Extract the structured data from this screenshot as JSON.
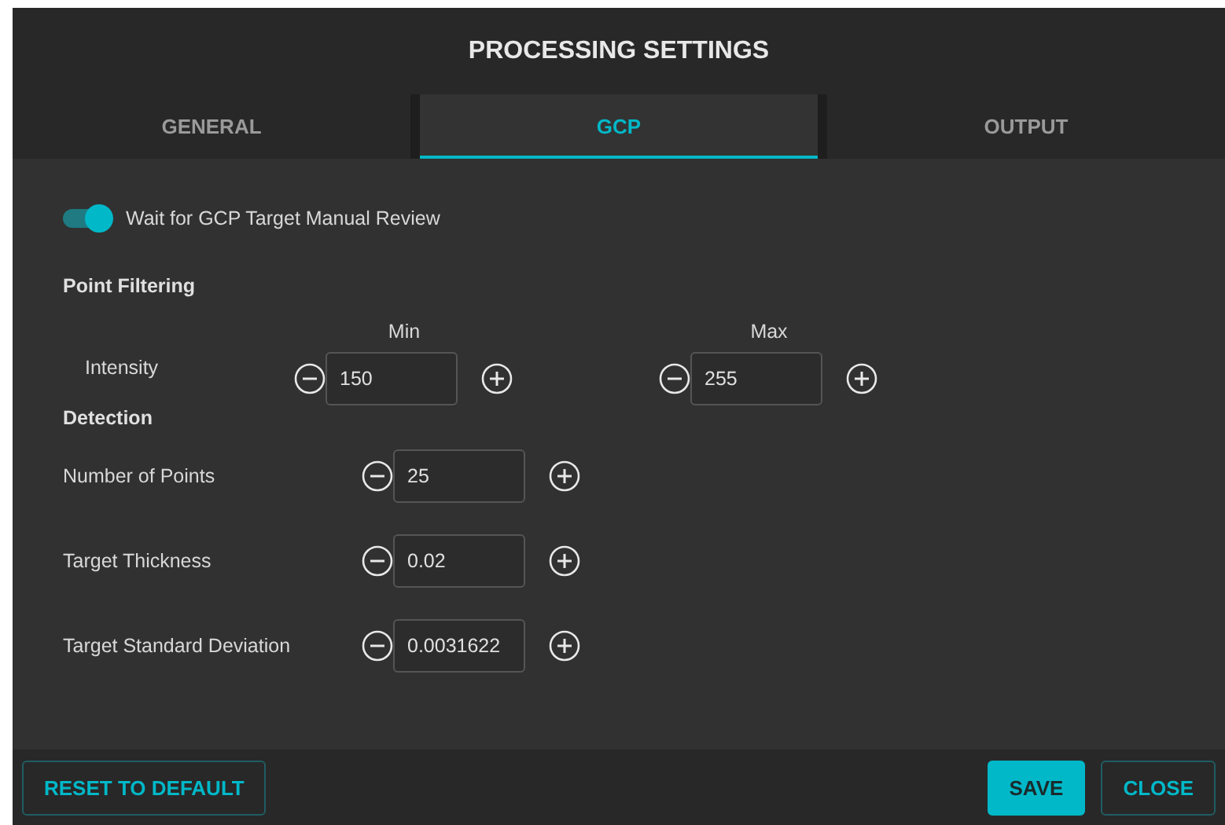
{
  "window": {
    "title": "PROCESSING SETTINGS"
  },
  "tabs": [
    {
      "label": "GENERAL",
      "selected": false
    },
    {
      "label": "GCP",
      "selected": true
    },
    {
      "label": "OUTPUT",
      "selected": false
    }
  ],
  "toggle": {
    "label": "Wait for GCP Target Manual Review",
    "on": true
  },
  "point_filtering": {
    "heading": "Point Filtering",
    "columns": [
      "Min",
      "Max"
    ],
    "rows": [
      {
        "label": "Intensity",
        "min": "150",
        "max": "255"
      }
    ]
  },
  "detection": {
    "heading": "Detection",
    "rows": [
      {
        "label": "Number of Points",
        "value": "25"
      },
      {
        "label": "Target Thickness",
        "value": "0.02"
      },
      {
        "label": "Target Standard Deviation",
        "value": "0.0031622"
      }
    ]
  },
  "footer": {
    "buttons": [
      {
        "label": "RESET TO DEFAULT",
        "kind": "outline"
      },
      {
        "label": "SAVE",
        "kind": "filled"
      },
      {
        "label": "CLOSE",
        "kind": "outline"
      }
    ]
  }
}
